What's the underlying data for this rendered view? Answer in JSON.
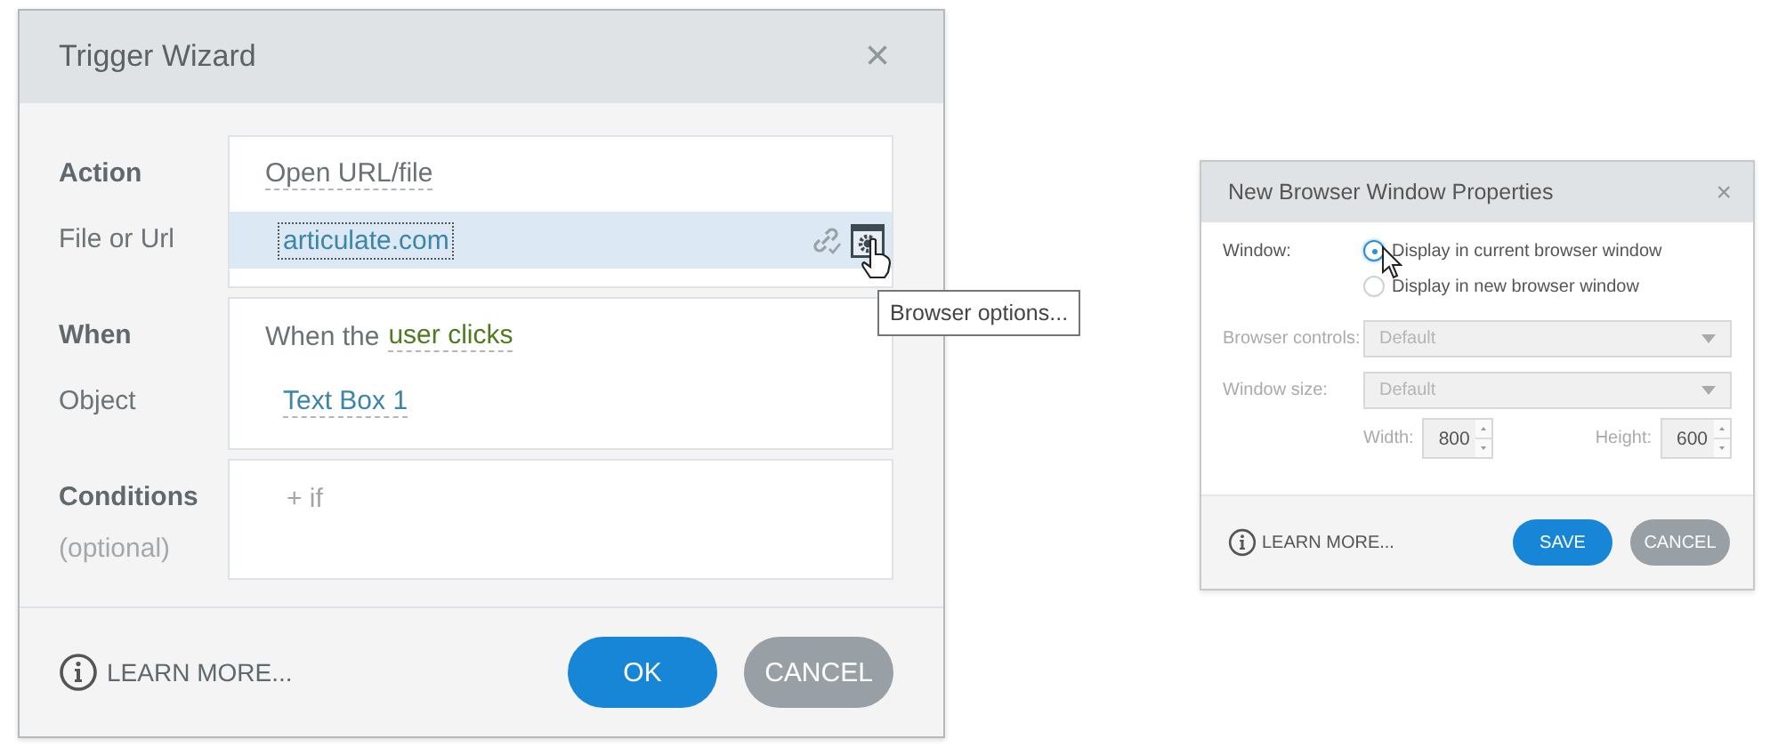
{
  "trigger_wizard": {
    "title": "Trigger Wizard",
    "close": "×",
    "sections": [
      {
        "rows": [
          {
            "label": "Action",
            "heading": true,
            "value": "Open URL/file",
            "kind": "menu",
            "selected": false
          },
          {
            "label": "File or Url",
            "heading": false,
            "value": "articulate.com",
            "kind": "url",
            "selected": true
          }
        ]
      },
      {
        "rows": [
          {
            "label": "When",
            "heading": true,
            "prefix": "When the",
            "value": "user clicks",
            "kind": "event",
            "selected": false
          },
          {
            "label": "Object",
            "heading": false,
            "value": "Text Box 1",
            "kind": "object",
            "selected": false
          }
        ]
      },
      {
        "rows": [
          {
            "label": "Conditions",
            "heading": true,
            "note": "(optional)",
            "value": "+ if",
            "kind": "add",
            "selected": false
          }
        ]
      }
    ],
    "tooltip": "Browser options...",
    "learn_more": "LEARN MORE...",
    "buttons": [
      {
        "label": "OK",
        "kind": "primary"
      },
      {
        "label": "CANCEL",
        "kind": "secondary"
      }
    ]
  },
  "browser_window": {
    "title": "New Browser Window Properties",
    "close": "×",
    "window_label": "Window:",
    "options": [
      {
        "label": "Display in current browser window",
        "selected": true
      },
      {
        "label": "Display in new browser window",
        "selected": false
      }
    ],
    "selects": [
      {
        "label": "Browser controls:",
        "value": "Default",
        "disabled": true
      },
      {
        "label": "Window size:",
        "value": "Default",
        "disabled": true
      }
    ],
    "size": [
      {
        "label": "Width:",
        "value": "800"
      },
      {
        "label": "Height:",
        "value": "600"
      }
    ],
    "learn_more": "LEARN MORE...",
    "buttons": [
      {
        "label": "SAVE",
        "kind": "primary"
      },
      {
        "label": "CANCEL",
        "kind": "secondary"
      }
    ]
  }
}
